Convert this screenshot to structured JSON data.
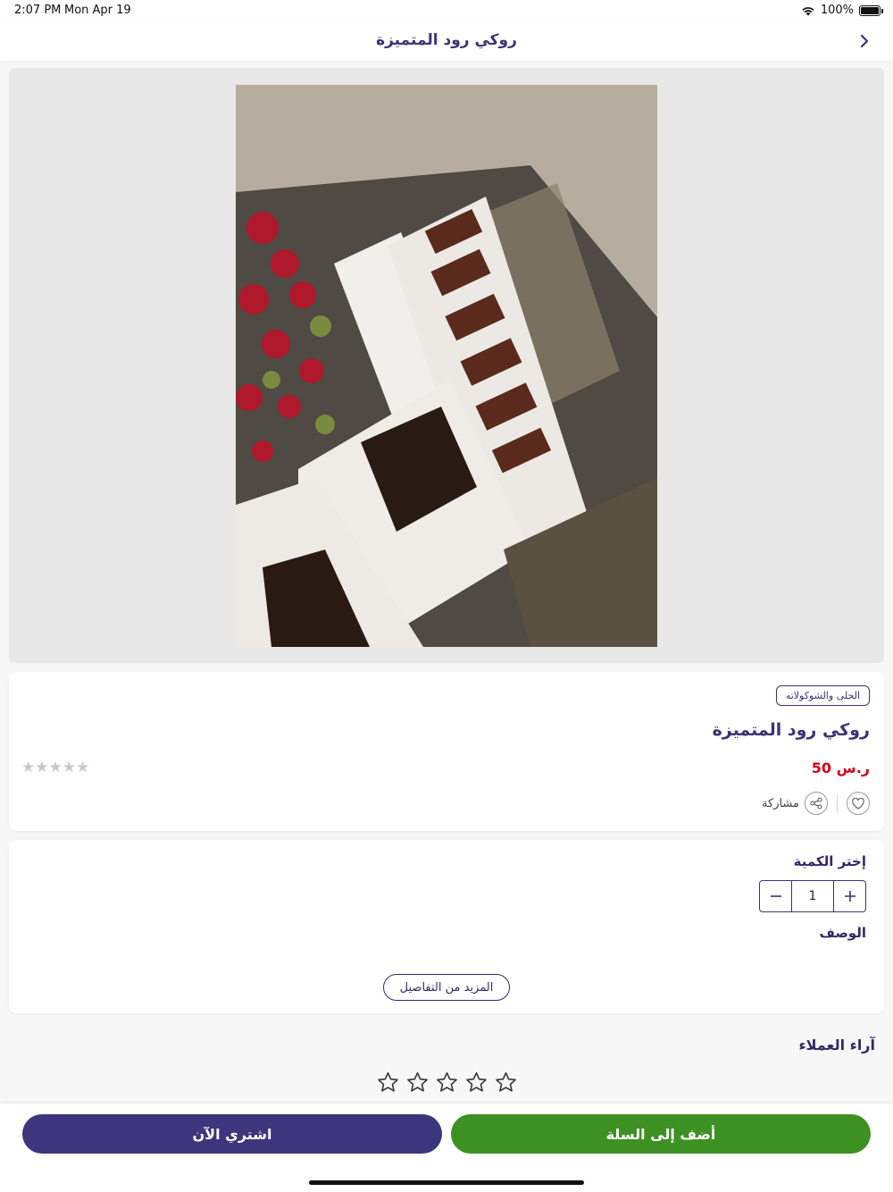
{
  "status_bar": {
    "time": "2:07 PM",
    "date": "Mon Apr 19",
    "battery": "100%"
  },
  "nav": {
    "title": "روكي رود المتميزة",
    "back_icon": "chevron-right-icon"
  },
  "product": {
    "image_alt": "product-photo",
    "category": "الحلى والشوكولاته",
    "name": "روكي رود المتميزة",
    "price": "50 ر.س",
    "rating": 0,
    "share_label": "مشاركة"
  },
  "quantity": {
    "label": "إختر الكمية",
    "value": "1",
    "plus": "+",
    "minus": "−"
  },
  "description": {
    "label": "الوصف",
    "more_button": "المزيد من التفاصيل"
  },
  "reviews": {
    "title": "آراء العملاء",
    "stars": 5
  },
  "actions": {
    "buy_now": "اشتري الآن",
    "add_to_cart": "أضف إلى السلة"
  },
  "colors": {
    "primary": "#3e367d",
    "success": "#3d9122",
    "price": "#d0021b"
  }
}
